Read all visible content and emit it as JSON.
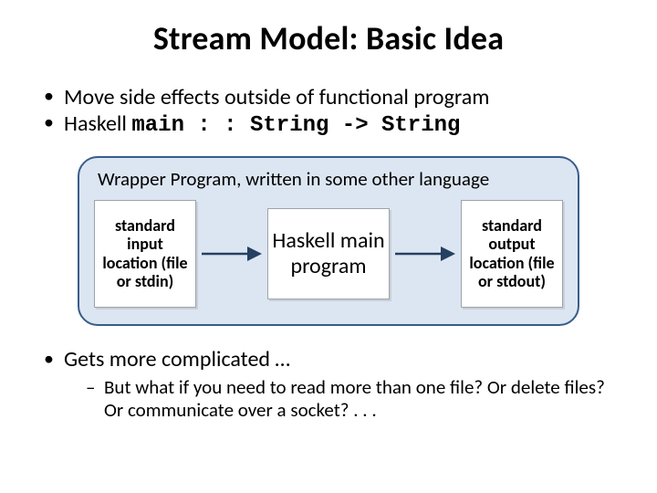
{
  "title": "Stream Model: Basic Idea",
  "bullets_top": [
    {
      "text": "Move side effects outside of functional program",
      "code": null
    },
    {
      "text": "Haskell ",
      "code": "main : : String -> String"
    }
  ],
  "diagram": {
    "wrapper_label": "Wrapper Program, written in some other language",
    "box1": "standard input location (file or stdin)",
    "box2": "Haskell main program",
    "box3": "standard output location (file or stdout)"
  },
  "bullets_bottom": {
    "main": "Gets more complicated …",
    "sub": "But what if you need to read more than one file? Or delete files? Or communicate over a socket? . . ."
  }
}
